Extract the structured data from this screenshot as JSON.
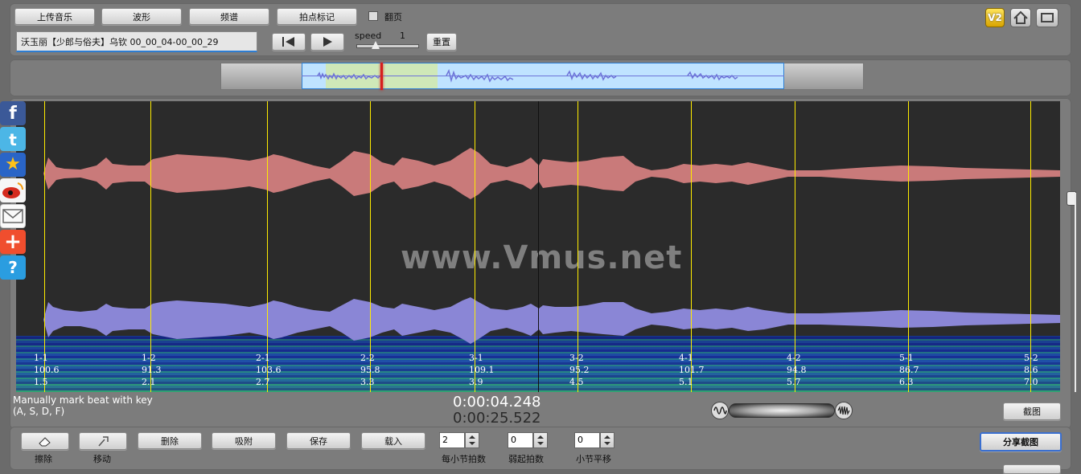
{
  "toolbar": {
    "upload": "上传音乐",
    "waveform": "波形",
    "spectrum": "频谱",
    "mark_beats": "拍点标记",
    "flip_label": "翻页",
    "badge_v2": "V2"
  },
  "track": {
    "title": "沃玉丽【少郎与俗夫】乌钦 00_00_04-00_00_29"
  },
  "playback": {
    "speed_label": "speed",
    "speed_value": "1",
    "reset": "重置"
  },
  "main": {
    "watermark": "www.Vmus.net",
    "hint_line1": "Manually mark beat with key",
    "hint_line2": "(A, S, D, F)",
    "current_time": "0:00:04.248",
    "total_time": "0:00:25.522",
    "screenshot": "截图",
    "share_screenshot": "分享截图"
  },
  "beats": [
    {
      "label": "1-1",
      "a": "100.6",
      "b": "1.5"
    },
    {
      "label": "1-2",
      "a": "91.3",
      "b": "2.1"
    },
    {
      "label": "2-1",
      "a": "103.6",
      "b": "2.7"
    },
    {
      "label": "2-2",
      "a": "95.8",
      "b": "3.3"
    },
    {
      "label": "3-1",
      "a": "109.1",
      "b": "3.9"
    },
    {
      "label": "3-2",
      "a": "95.2",
      "b": "4.5"
    },
    {
      "label": "4-1",
      "a": "101.7",
      "b": "5.1"
    },
    {
      "label": "4-2",
      "a": "94.8",
      "b": "5.7"
    },
    {
      "label": "5-1",
      "a": "86.7",
      "b": "6.3"
    },
    {
      "label": "5-2",
      "a": "8.6",
      "b": "7.0"
    }
  ],
  "bottom": {
    "erase": "擦除",
    "move": "移动",
    "delete": "删除",
    "snap": "吸附",
    "save": "保存",
    "load": "载入",
    "beats_per_bar_value": "2",
    "beats_per_bar_label": "每小节拍数",
    "pickup_value": "0",
    "pickup_label": "弱起拍数",
    "bar_shift_value": "0",
    "bar_shift_label": "小节平移"
  },
  "social": [
    "facebook-icon",
    "twitter-icon",
    "favorite-star-icon",
    "weibo-icon",
    "mail-icon",
    "add-icon",
    "help-icon"
  ],
  "colors": {
    "upper_wave": "#c97a7a",
    "lower_wave": "#8a86d6",
    "beat_line": "#ffec00",
    "selection": "#bfe3ff",
    "selection_green": "#cfe8b8"
  }
}
